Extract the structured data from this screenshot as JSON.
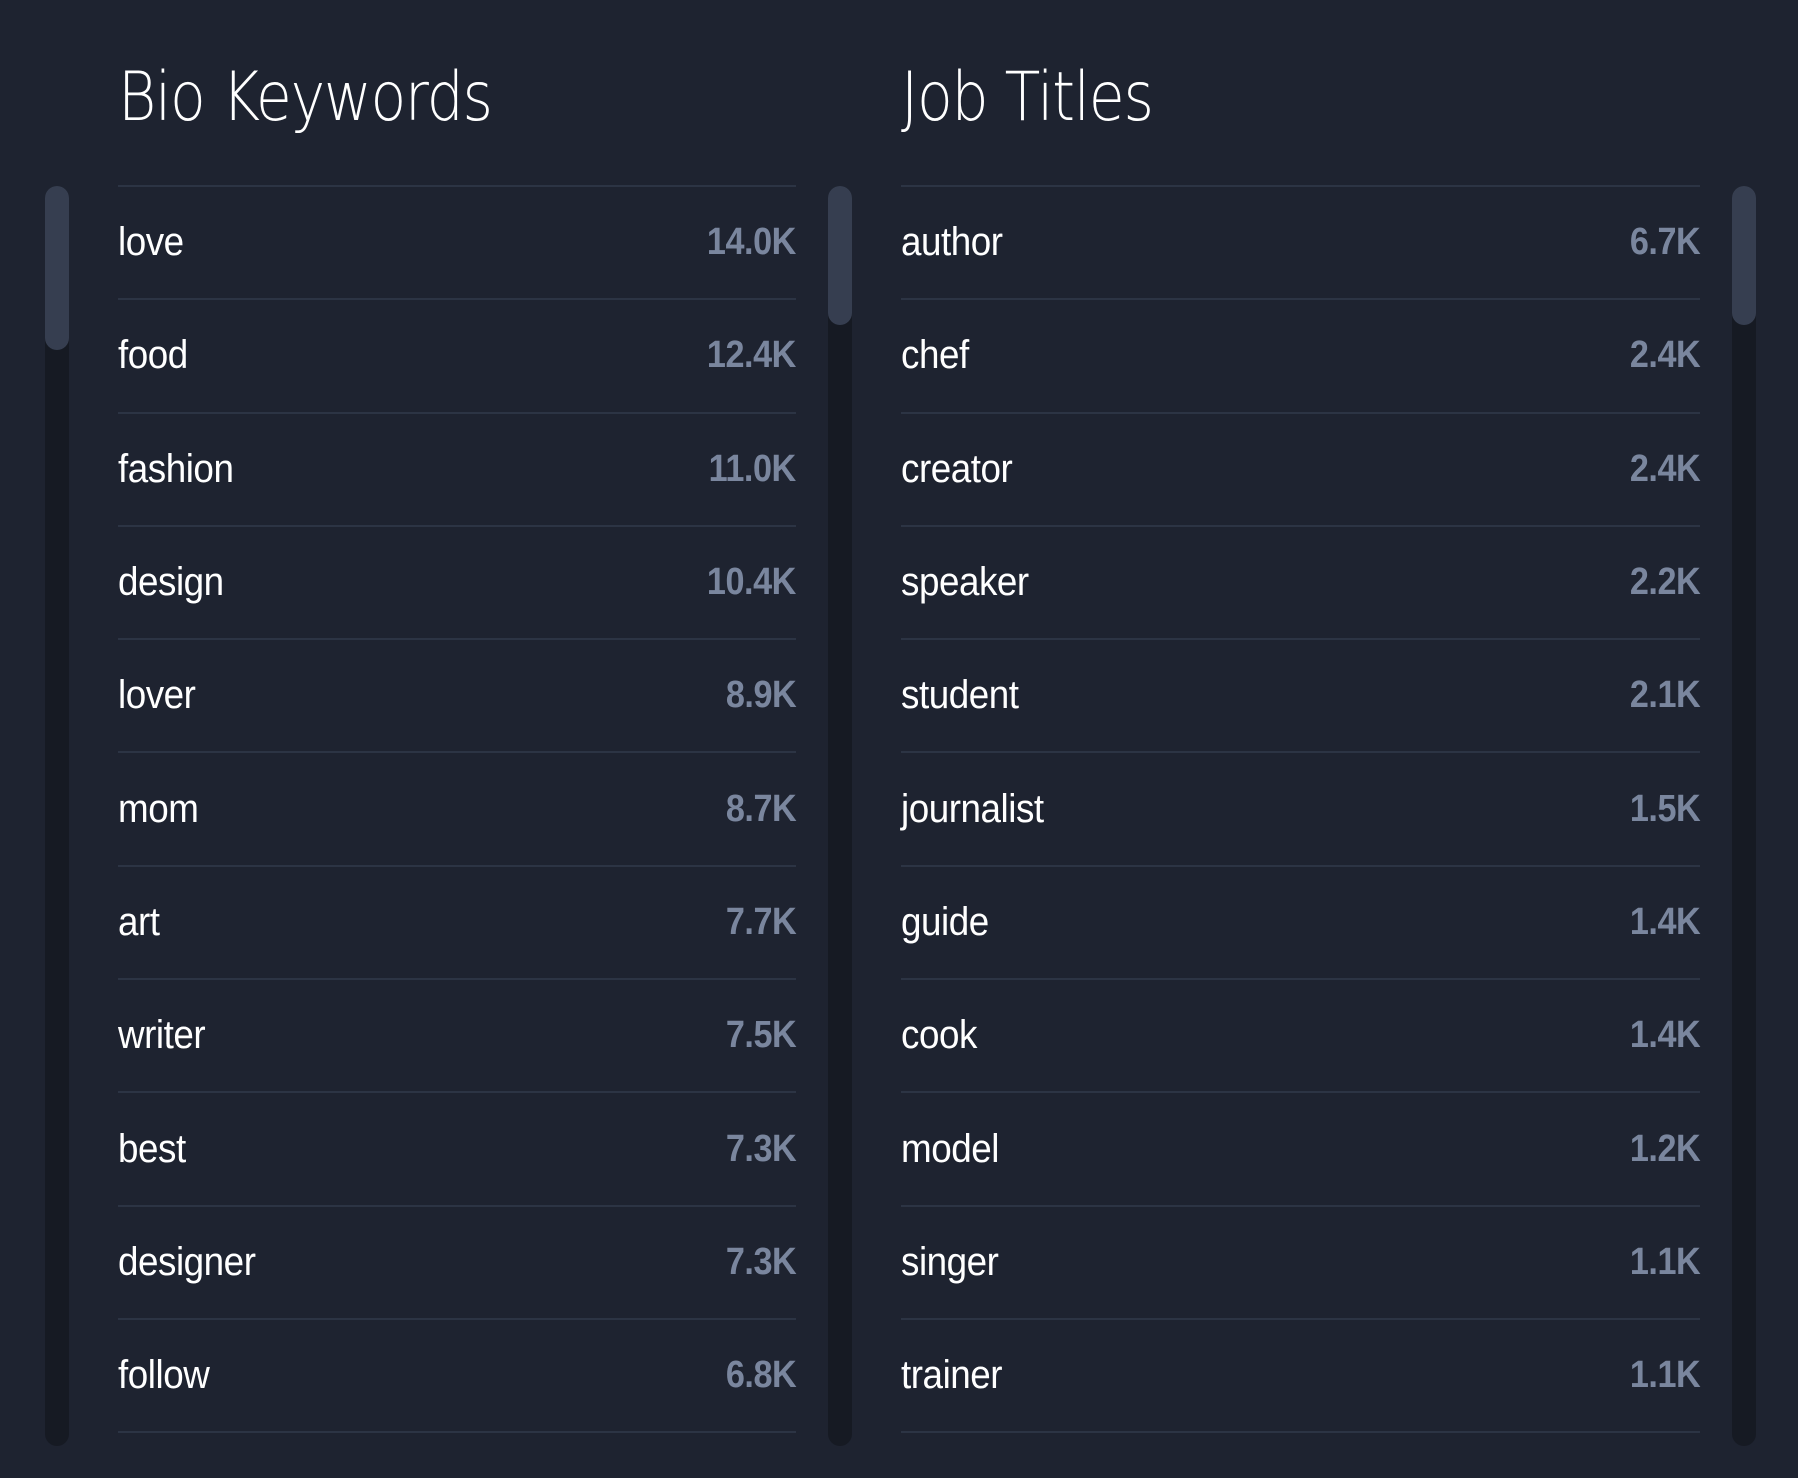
{
  "panels": {
    "bio_keywords": {
      "title": "Bio Keywords",
      "scroll_position": 0,
      "items": [
        {
          "label": "love",
          "value": "14.0K"
        },
        {
          "label": "food",
          "value": "12.4K"
        },
        {
          "label": "fashion",
          "value": "11.0K"
        },
        {
          "label": "design",
          "value": "10.4K"
        },
        {
          "label": "lover",
          "value": "8.9K"
        },
        {
          "label": "mom",
          "value": "8.7K"
        },
        {
          "label": "art",
          "value": "7.7K"
        },
        {
          "label": "writer",
          "value": "7.5K"
        },
        {
          "label": "best",
          "value": "7.3K"
        },
        {
          "label": "designer",
          "value": "7.3K"
        },
        {
          "label": "follow",
          "value": "6.8K"
        }
      ]
    },
    "job_titles": {
      "title": "Job Titles",
      "scroll_position": 0,
      "items": [
        {
          "label": "author",
          "value": "6.7K"
        },
        {
          "label": "chef",
          "value": "2.4K"
        },
        {
          "label": "creator",
          "value": "2.4K"
        },
        {
          "label": "speaker",
          "value": "2.2K"
        },
        {
          "label": "student",
          "value": "2.1K"
        },
        {
          "label": "journalist",
          "value": "1.5K"
        },
        {
          "label": "guide",
          "value": "1.4K"
        },
        {
          "label": "cook",
          "value": "1.4K"
        },
        {
          "label": "model",
          "value": "1.2K"
        },
        {
          "label": "singer",
          "value": "1.1K"
        },
        {
          "label": "trainer",
          "value": "1.1K"
        }
      ]
    }
  },
  "colors": {
    "background": "#1e2330",
    "label": "#ffffff",
    "value": "#7a869e",
    "divider": "#2c3444",
    "scroll_track": "#161a23",
    "scroll_thumb": "#363e50"
  }
}
